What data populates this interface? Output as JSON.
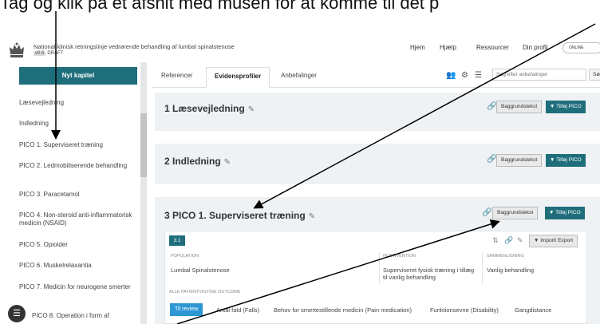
{
  "caption": "Tag og klik på et afsnit med musen for at komme til det p",
  "header": {
    "title": "National klinisk retningslinje vedrørende behandling af lumbal spinalstenose",
    "version": "v0.5",
    "version_status": "DRAFT",
    "nav": [
      "Hjem",
      "Hjælp",
      "Ressourcer",
      "Din profil"
    ],
    "toggle_label": "ONLINE"
  },
  "sidebar": {
    "new_chapter": "Nyt kapitel",
    "items": [
      "Læsevejledning",
      "Indledning",
      "PICO 1. Superviseret træning",
      "PICO 2. Ledmobiliserende behandling",
      "PICO 3. Paracetamol",
      "PICO 4. Non-steroid anti-inflammatorisk medicin (NSAID)",
      "PICO 5. Opioider",
      "PICO 6. Muskelrelaxantia",
      "PICO 7. Medicin for neurogene smerter",
      "PICO 8. Operation i form af"
    ]
  },
  "tabs": [
    "Referencer",
    "Evidensprofiler",
    "Anbefalinger"
  ],
  "search": {
    "placeholder": "Søg efter anbefalinger",
    "button": "Søg"
  },
  "chapters": [
    {
      "title": "1 Læsevejledning",
      "background": "Baggrundstekst",
      "add_pico": "▼ Tilføj PICO"
    },
    {
      "title": "2 Indledning",
      "background": "Baggrundstekst",
      "add_pico": "▼ Tilføj PICO"
    },
    {
      "title": "3 PICO 1. Superviseret træning",
      "background": "Baggrundstekst",
      "add_pico": "▼ Tilføj PICO"
    }
  ],
  "pico": {
    "badge": "3.1",
    "import_export": "▼ Import/ Export",
    "population_label": "POPULATION",
    "population": "Lumbal Spinalstenose",
    "intervention_label": "INTERVENTION",
    "intervention": "Superviseret fysisk træning i tillæg til vanlig behandling",
    "comparison_label": "SAMMENLIGNING",
    "comparison": "Vanlig behandling",
    "outcomes_label": "ALLE PATIENTVIGTIGE OUTCOME",
    "review_chip": "Til review",
    "outcomes": [
      "Antal fald (Falls)",
      "Behov for smertestillende medicin (Pain medication)",
      "Funktionsevne (Disability)",
      "Gangdistance"
    ]
  },
  "colors": {
    "teal": "#1f6e7c",
    "panel": "#eef2f5",
    "review_blue": "#2d97d4"
  }
}
